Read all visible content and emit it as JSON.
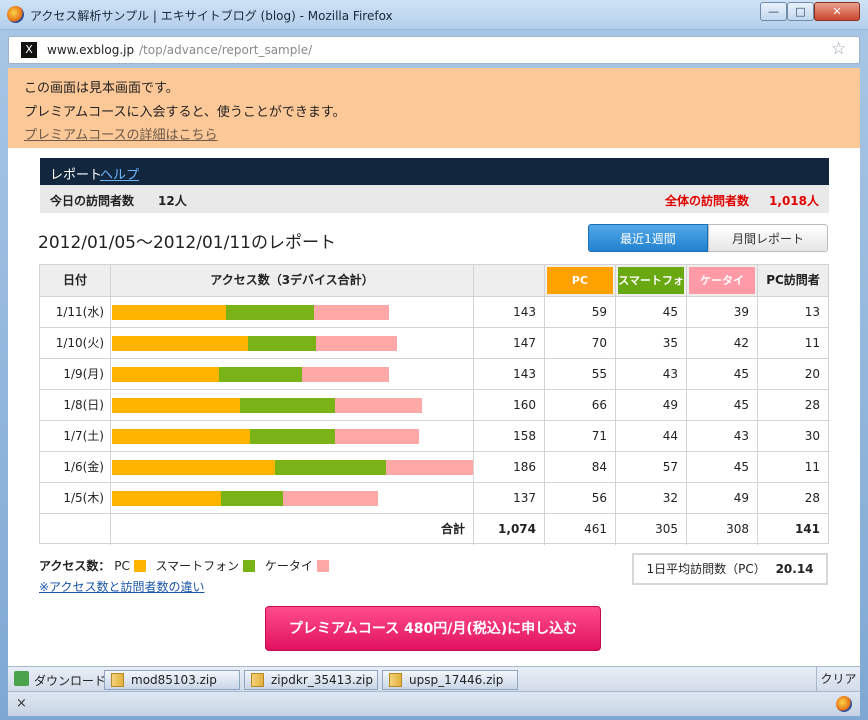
{
  "window": {
    "title": "アクセス解析サンプル | エキサイトブログ (blog) - Mozilla Firefox",
    "min_glyph": "—",
    "max_glyph": "□",
    "close_glyph": "✕"
  },
  "urlbar": {
    "domain": "www.exblog.jp",
    "path": "/top/advance/report_sample/",
    "site_glyph": "X",
    "star_glyph": "☆"
  },
  "notice": {
    "line1": "この画面は見本画面です。",
    "line2": "プレミアムコースに入会すると、使うことができます。",
    "link": "プレミアムコースの詳細はこちら"
  },
  "report": {
    "label": "レポート",
    "help": "ヘルプ",
    "today_label": "今日の訪問者数",
    "today_value": "12人",
    "total_label": "全体の訪問者数",
    "total_value": "1,018人",
    "period_title": "2012/01/05～2012/01/11のレポート",
    "tab_weekly": "最近1週間",
    "tab_monthly": "月間レポート"
  },
  "table": {
    "headers": {
      "date": "日付",
      "access": "アクセス数（3デバイス合計）",
      "pc": "PC",
      "smartphone": "スマートフォン",
      "keitai": "ケータイ",
      "pc_visitors": "PC訪問者"
    },
    "rows": [
      {
        "date": "1/11(水)",
        "total": "143",
        "pc": "59",
        "sp": "45",
        "kt": "39",
        "visitors": "13"
      },
      {
        "date": "1/10(火)",
        "total": "147",
        "pc": "70",
        "sp": "35",
        "kt": "42",
        "visitors": "11"
      },
      {
        "date": "1/9(月)",
        "total": "143",
        "pc": "55",
        "sp": "43",
        "kt": "45",
        "visitors": "20"
      },
      {
        "date": "1/8(日)",
        "total": "160",
        "pc": "66",
        "sp": "49",
        "kt": "45",
        "visitors": "28"
      },
      {
        "date": "1/7(土)",
        "total": "158",
        "pc": "71",
        "sp": "44",
        "kt": "43",
        "visitors": "30"
      },
      {
        "date": "1/6(金)",
        "total": "186",
        "pc": "84",
        "sp": "57",
        "kt": "45",
        "visitors": "11"
      },
      {
        "date": "1/5(木)",
        "total": "137",
        "pc": "56",
        "sp": "32",
        "kt": "49",
        "visitors": "28"
      }
    ],
    "totals": {
      "label": "合計",
      "total": "1,074",
      "pc": "461",
      "sp": "305",
      "kt": "308",
      "visitors": "141"
    }
  },
  "legend": {
    "title": "アクセス数：",
    "pc": "PC",
    "sp": "スマートフォン",
    "kt": "ケータイ",
    "link": "※アクセス数と訪問者数の違い"
  },
  "average": {
    "label": "1日平均訪問数（PC）",
    "value": "20.14"
  },
  "premium_button": "プレミアムコース 480円/月(税込)に申し込む",
  "downloads": {
    "label": "ダウンロード",
    "items": [
      "mod85103.zip",
      "zipdkr_35413.zip",
      "upsp_17446.zip"
    ],
    "clear": "クリア"
  },
  "statusbar": {
    "close_glyph": "×"
  },
  "colors": {
    "pc": "#ffb400",
    "smartphone": "#7ab317",
    "keitai": "#ffa8a8",
    "header_dark": "#12263e",
    "notice_bg": "#fdc898",
    "total_red": "#e00000"
  },
  "icons": [
    "firefox-icon",
    "site-favicon-icon",
    "bookmark-star-icon",
    "download-icon",
    "zip-file-icon"
  ]
}
